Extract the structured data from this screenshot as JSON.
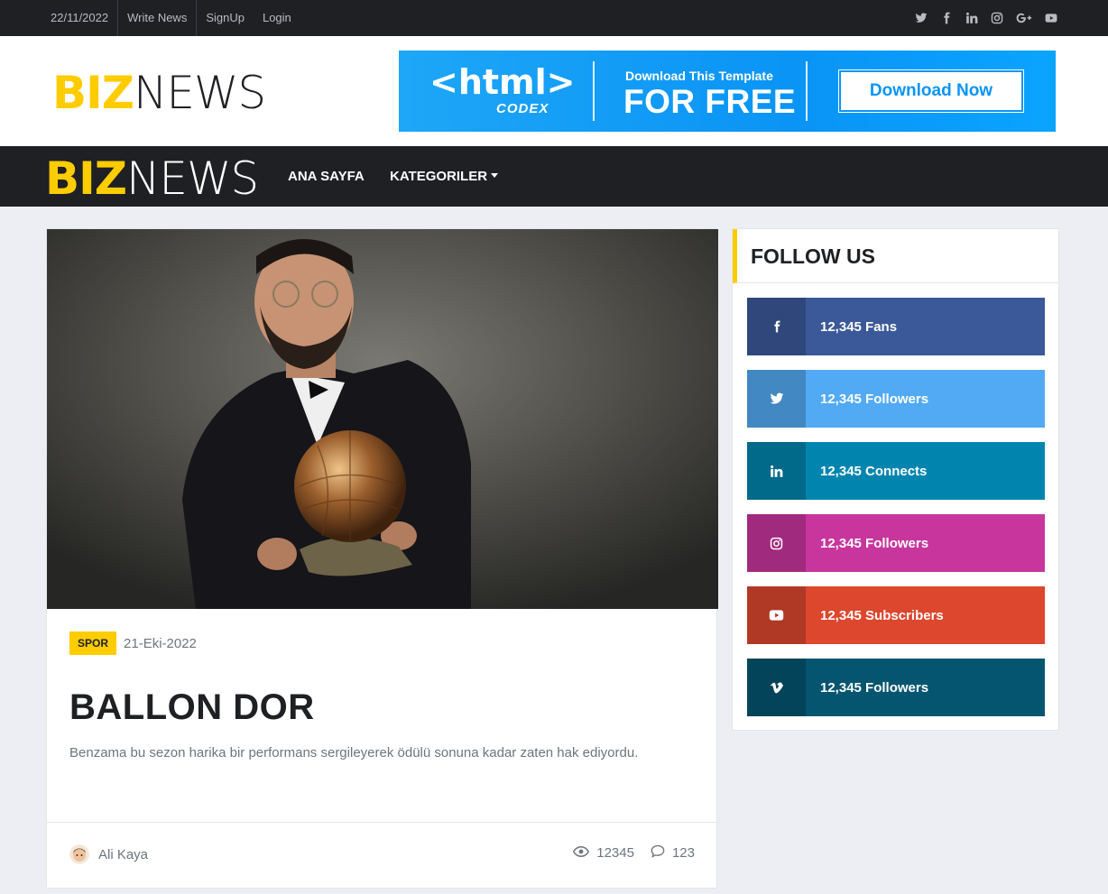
{
  "topbar": {
    "date": "22/11/2022",
    "links": [
      "Write News",
      "SignUp",
      "Login"
    ],
    "social_icons": [
      "twitter-icon",
      "facebook-icon",
      "linkedin-icon",
      "instagram-icon",
      "google-plus-icon",
      "youtube-icon"
    ]
  },
  "brand": {
    "part1": "BIZ",
    "part2": "NEWS",
    "accent": "#FFCC00"
  },
  "banner": {
    "mark": "<html>",
    "sub": "CODEX",
    "small": "Download This Template",
    "big": "FOR FREE",
    "button": "Download Now"
  },
  "nav": {
    "items": [
      "ANA SAYFA",
      "KATEGORILER"
    ]
  },
  "article": {
    "category": "SPOR",
    "date": "21-Eki-2022",
    "title": "BALLON DOR",
    "excerpt": "Benzama bu sezon harika bir performans sergileyerek ödülü sonuna kadar zaten hak ediyordu.",
    "author": "Ali Kaya",
    "views": "12345",
    "comments": "123"
  },
  "follow": {
    "title": "FOLLOW US",
    "items": [
      {
        "icon": "facebook-icon",
        "label": "12,345 Fans",
        "color": "#3B5998",
        "dark": "#2F477A"
      },
      {
        "icon": "twitter-icon",
        "label": "12,345 Followers",
        "color": "#52AAF4",
        "dark": "#4288C3"
      },
      {
        "icon": "linkedin-icon",
        "label": "12,345 Connects",
        "color": "#0185AE",
        "dark": "#016A8B"
      },
      {
        "icon": "instagram-icon",
        "label": "12,345 Followers",
        "color": "#C8359D",
        "dark": "#A02A7E"
      },
      {
        "icon": "youtube-icon",
        "label": "12,345 Subscribers",
        "color": "#DC472E",
        "dark": "#B03925"
      },
      {
        "icon": "vimeo-icon",
        "label": "12,345 Followers",
        "color": "#055570",
        "dark": "#04445A"
      }
    ]
  }
}
